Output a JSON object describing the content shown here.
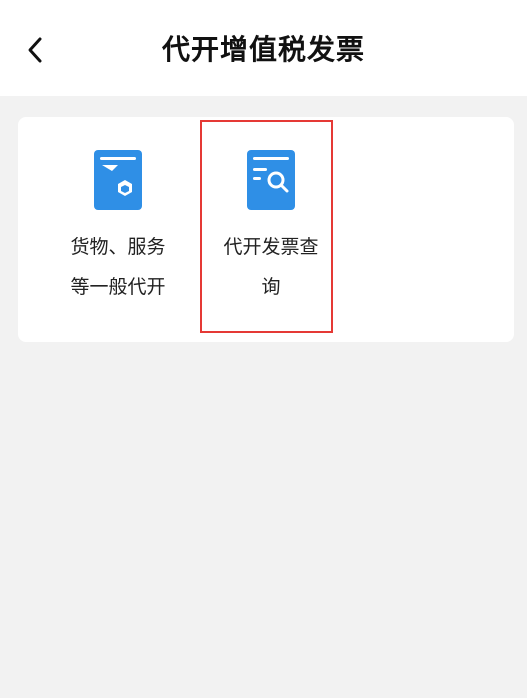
{
  "header": {
    "back_icon": "chevron-left-icon",
    "title": "代开增值税发票"
  },
  "tiles": [
    {
      "label": "货物、服务\n等一般代开",
      "icon": "invoice-box-icon"
    },
    {
      "label": "代开发票查\n询",
      "icon": "invoice-search-icon"
    }
  ],
  "colors": {
    "accent": "#2f8fe6",
    "highlight": "#e53935",
    "background": "#f2f2f2"
  }
}
